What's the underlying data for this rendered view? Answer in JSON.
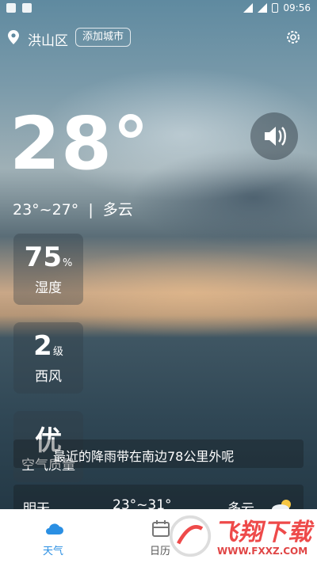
{
  "status_bar": {
    "time": "09:56"
  },
  "header": {
    "city": "洪山区",
    "add_city_label": "添加城市"
  },
  "current": {
    "temperature": "28°",
    "range": "23°~27°",
    "condition": "多云",
    "separator": "|"
  },
  "cards": [
    {
      "value": "75",
      "unit": "%",
      "label": "湿度"
    },
    {
      "value": "2",
      "unit": "级",
      "label": "西风"
    },
    {
      "value": "优",
      "unit": "",
      "label": "空气质量"
    }
  ],
  "rain_notice": "最近的降雨带在南边78公里外呢",
  "forecast": {
    "day": "明天",
    "temp": "23°~31°",
    "condition": "多云",
    "icon": "partly-cloudy-icon"
  },
  "tabs": [
    {
      "label": "天气",
      "icon": "cloud-icon",
      "active": true
    },
    {
      "label": "日历",
      "icon": "calendar-icon",
      "active": false
    }
  ],
  "watermark": {
    "text": "飞翔下载",
    "url": "WWW.FXXZ.COM"
  },
  "colors": {
    "accent": "#2a8fe3",
    "watermark": "#ee4a4a"
  }
}
